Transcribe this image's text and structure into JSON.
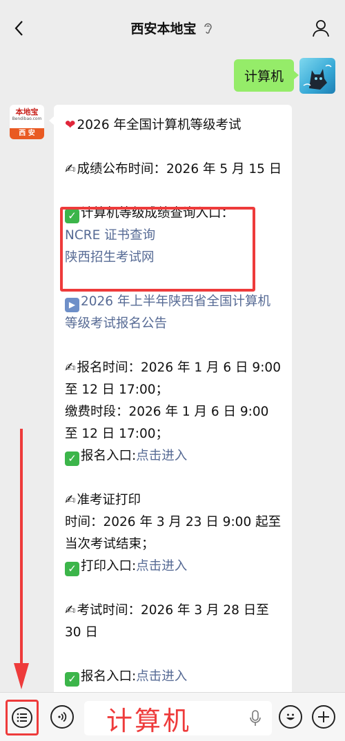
{
  "header": {
    "title": "西安本地宝"
  },
  "outgoing": {
    "text": "计算机"
  },
  "logo": {
    "top": "本地宝",
    "sub": "Bendibao.com",
    "bottom": "西 安"
  },
  "message": {
    "line1": "2026 年全国计算机等级考试",
    "score_time": "成绩公布时间：2026 年 5 月 15 日",
    "query_entry_label": "计算机等级成绩查询入口：",
    "link_ncre": "NCRE 证书查询",
    "link_shaanxi": "陕西招生考试网",
    "notice_link": "2026 年上半年陕西省全国计算机等级考试报名公告",
    "signup_time": "报名时间：2026 年 1 月 6 日 9:00 至 12 日 17:00；",
    "payment_time": "缴费时段：2026 年 1 月 6 日 9:00 至 12 日 17:00；",
    "signup_entry_label": "报名入口:",
    "signup_entry_link": "点击进入",
    "admit_title": "准考证打印",
    "admit_time": "时间：2026 年 3 月 23 日 9:00 起至当次考试结束；",
    "print_entry_label": "打印入口:",
    "print_entry_link": "点击进入",
    "exam_time": "考试时间：2026 年 3 月 28 日至 30 日",
    "signup_entry_label_2": "报名入口:",
    "signup_entry_link_2": "点击进入"
  },
  "input": {
    "value": "计算机"
  },
  "colors": {
    "accent_red": "#ee3b3b",
    "link_blue": "#576b95",
    "bubble_green": "#95ec69"
  }
}
